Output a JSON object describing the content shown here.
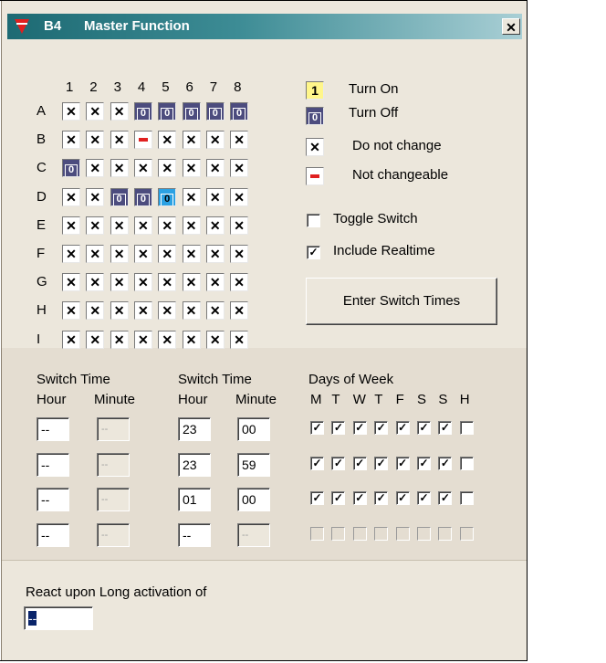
{
  "window": {
    "id_label": "B4",
    "title": "Master Function",
    "close_glyph": "✕"
  },
  "grid": {
    "columns": [
      "1",
      "2",
      "3",
      "4",
      "5",
      "6",
      "7",
      "8"
    ],
    "rows": [
      {
        "label": "A",
        "cells": [
          "x",
          "x",
          "x",
          "off",
          "off",
          "off",
          "off",
          "off"
        ]
      },
      {
        "label": "B",
        "cells": [
          "x",
          "x",
          "x",
          "nc",
          "x",
          "x",
          "x",
          "x"
        ]
      },
      {
        "label": "C",
        "cells": [
          "off",
          "x",
          "x",
          "x",
          "x",
          "x",
          "x",
          "x"
        ]
      },
      {
        "label": "D",
        "cells": [
          "x",
          "x",
          "off",
          "off",
          "sel",
          "x",
          "x",
          "x"
        ]
      },
      {
        "label": "E",
        "cells": [
          "x",
          "x",
          "x",
          "x",
          "x",
          "x",
          "x",
          "x"
        ]
      },
      {
        "label": "F",
        "cells": [
          "x",
          "x",
          "x",
          "x",
          "x",
          "x",
          "x",
          "x"
        ]
      },
      {
        "label": "G",
        "cells": [
          "x",
          "x",
          "x",
          "x",
          "x",
          "x",
          "x",
          "x"
        ]
      },
      {
        "label": "H",
        "cells": [
          "x",
          "x",
          "x",
          "x",
          "x",
          "x",
          "x",
          "x"
        ]
      },
      {
        "label": "I",
        "cells": [
          "x",
          "x",
          "x",
          "x",
          "x",
          "x",
          "x",
          "x"
        ]
      }
    ],
    "glyph_x": "✕",
    "glyph_on": "1",
    "glyph_off": "0"
  },
  "legend": {
    "turn_on": "Turn On",
    "turn_off": "Turn Off",
    "do_not_change": "Do not change",
    "not_changeable": "Not changeable"
  },
  "options": {
    "toggle_switch_label": "Toggle Switch",
    "toggle_switch_checked": false,
    "include_realtime_label": "Include Realtime",
    "include_realtime_checked": true,
    "enter_switch_times_label": "Enter Switch Times"
  },
  "switch_times": {
    "group1_title": "Switch Time",
    "group2_title": "Switch Time",
    "hour_label": "Hour",
    "minute_label": "Minute",
    "days_title": "Days of Week",
    "day_letters": [
      "M",
      "T",
      "W",
      "T",
      "F",
      "S",
      "S",
      "H"
    ],
    "rows": [
      {
        "h1": "--",
        "m1": "--",
        "h2": "23",
        "m2": "00",
        "days": [
          true,
          true,
          true,
          true,
          true,
          true,
          true,
          false
        ]
      },
      {
        "h1": "--",
        "m1": "--",
        "h2": "23",
        "m2": "59",
        "days": [
          true,
          true,
          true,
          true,
          true,
          true,
          true,
          false
        ]
      },
      {
        "h1": "--",
        "m1": "--",
        "h2": "01",
        "m2": "00",
        "days": [
          true,
          true,
          true,
          true,
          true,
          true,
          true,
          false
        ]
      },
      {
        "h1": "--",
        "m1": "--",
        "h2": "--",
        "m2": "--",
        "days": [
          false,
          false,
          false,
          false,
          false,
          false,
          false,
          false
        ]
      }
    ]
  },
  "long_activation": {
    "label": "React upon Long activation of",
    "value": "--"
  },
  "colors": {
    "turn_off_cell": "#4c4c7e",
    "turn_on_cell": "#fff68a",
    "selected_cell": "#2ba1e3",
    "not_changeable_mark": "#e02020",
    "titlebar_start": "#1d6a73"
  }
}
